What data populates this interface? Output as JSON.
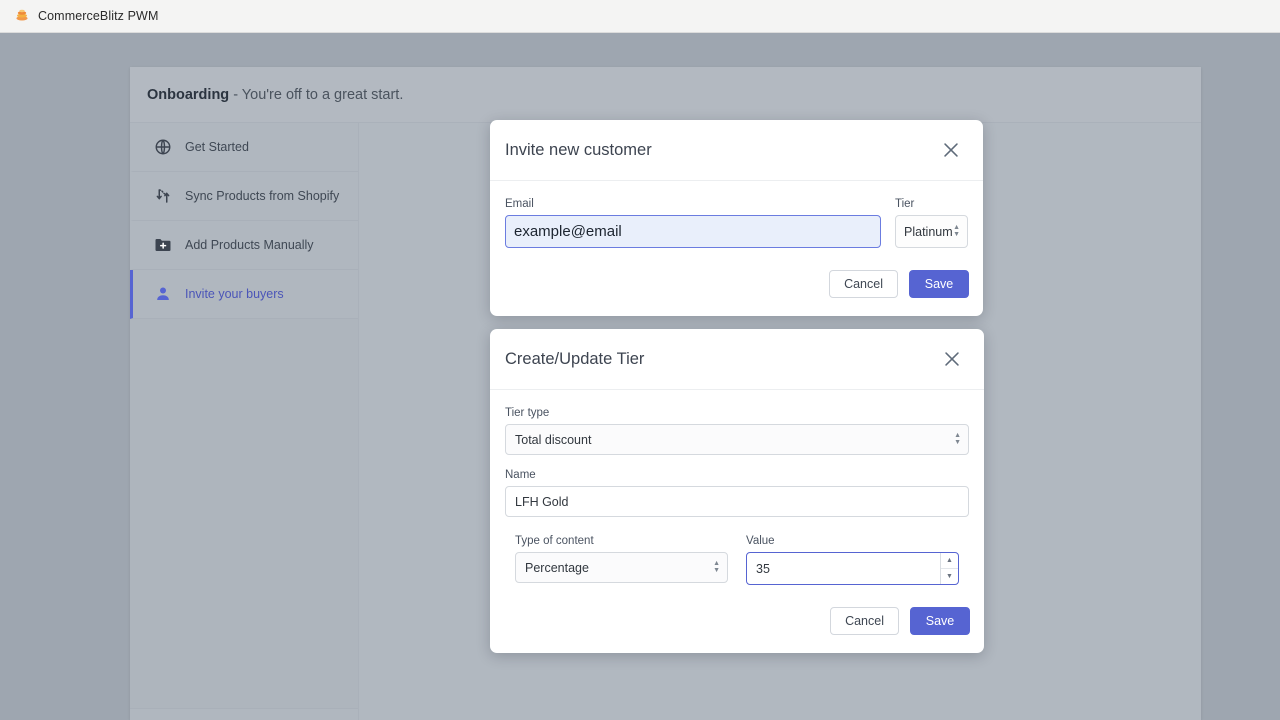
{
  "browser": {
    "tab_title": "CommerceBlitz PWM",
    "favicon_name": "commerceblitz-logo-icon",
    "favicon_color": "#f08a3c"
  },
  "app": {
    "header_title": "Onboarding",
    "header_subtitle": "- You're off to a great start.",
    "sidebar": {
      "items": [
        {
          "label": "Get Started",
          "icon": "globe-icon",
          "active": false
        },
        {
          "label": "Sync Products from Shopify",
          "icon": "sync-arrows-icon",
          "active": false
        },
        {
          "label": "Add Products Manually",
          "icon": "folder-plus-icon",
          "active": false
        },
        {
          "label": "Invite your buyers",
          "icon": "person-icon",
          "active": true
        }
      ]
    }
  },
  "colors": {
    "accent": "#5664d2",
    "backdrop": "#9ea6b0",
    "focus_border": "#5664d2"
  },
  "modals": {
    "invite": {
      "title": "Invite new customer",
      "close_icon": "close-icon",
      "email_label": "Email",
      "email_value": "example@email",
      "email_placeholder": "example@email",
      "tier_label": "Tier",
      "tier_value": "Platinum",
      "tier_options": [
        "Platinum"
      ],
      "cancel_label": "Cancel",
      "save_label": "Save"
    },
    "tier": {
      "title": "Create/Update Tier",
      "close_icon": "close-icon",
      "tier_type_label": "Tier type",
      "tier_type_value": "Total discount",
      "tier_type_options": [
        "Total discount"
      ],
      "name_label": "Name",
      "name_value": "LFH Gold",
      "content_type_label": "Type of content",
      "content_type_value": "Percentage",
      "content_type_options": [
        "Percentage"
      ],
      "value_label": "Value",
      "value_value": "35",
      "cancel_label": "Cancel",
      "save_label": "Save"
    }
  }
}
